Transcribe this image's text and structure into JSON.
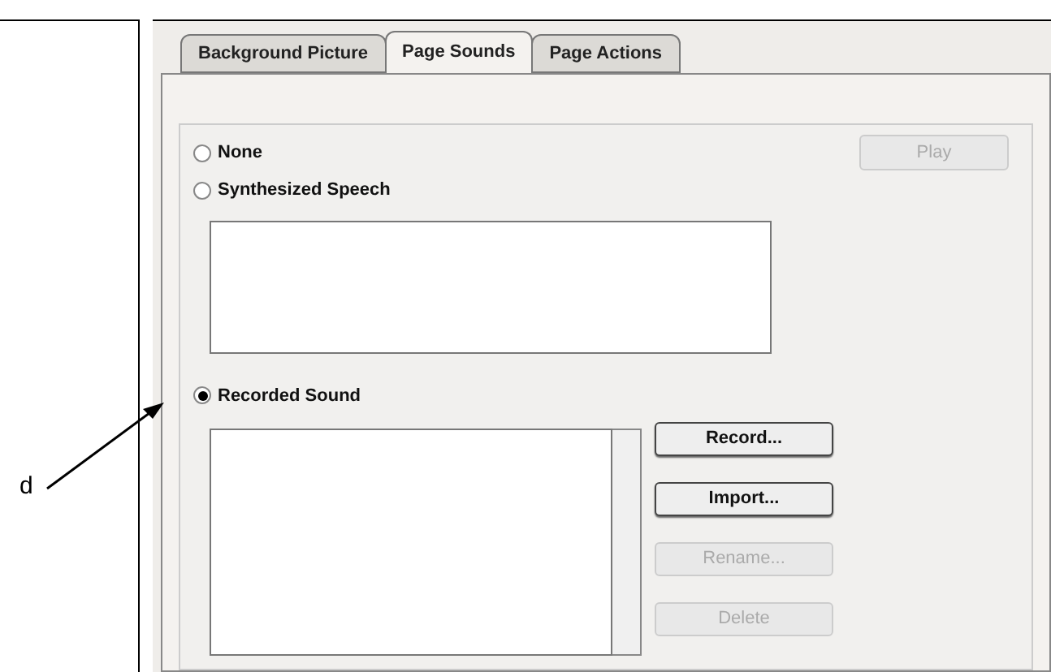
{
  "annotation": {
    "label": "d"
  },
  "tabs": [
    {
      "label": "Background Picture",
      "selected": false
    },
    {
      "label": "Page Sounds",
      "selected": true
    },
    {
      "label": "Page Actions",
      "selected": false
    }
  ],
  "options": [
    {
      "label": "None",
      "selected": false
    },
    {
      "label": "Synthesized Speech",
      "selected": false
    },
    {
      "label": "Recorded Sound",
      "selected": true
    }
  ],
  "play_button": {
    "label": "Play",
    "disabled": true
  },
  "sound_buttons": [
    {
      "label": "Record...",
      "disabled": false
    },
    {
      "label": "Import...",
      "disabled": false
    },
    {
      "label": "Rename...",
      "disabled": true
    },
    {
      "label": "Delete",
      "disabled": true
    }
  ]
}
